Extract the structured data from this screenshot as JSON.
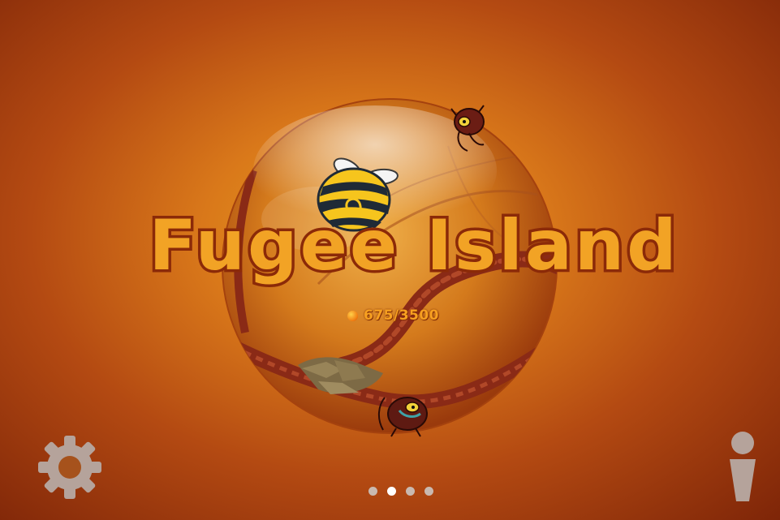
{
  "game": {
    "title_line": "Fugee Island",
    "progress": {
      "current": 675,
      "total": 3500,
      "label": "675/3500"
    }
  },
  "pager": {
    "page_count": 4,
    "active_index": 1
  },
  "controls": {
    "settings_icon": "gear-icon",
    "info_icon": "info-icon"
  },
  "colors": {
    "background_center": "#e9a020",
    "background_edge": "#7e2508",
    "title_fill": "#f2a325",
    "title_outline": "#8b2a08",
    "progress_text": "#f7a020",
    "dot_active": "#ffffff",
    "dot_inactive": "#c9b9b0"
  }
}
